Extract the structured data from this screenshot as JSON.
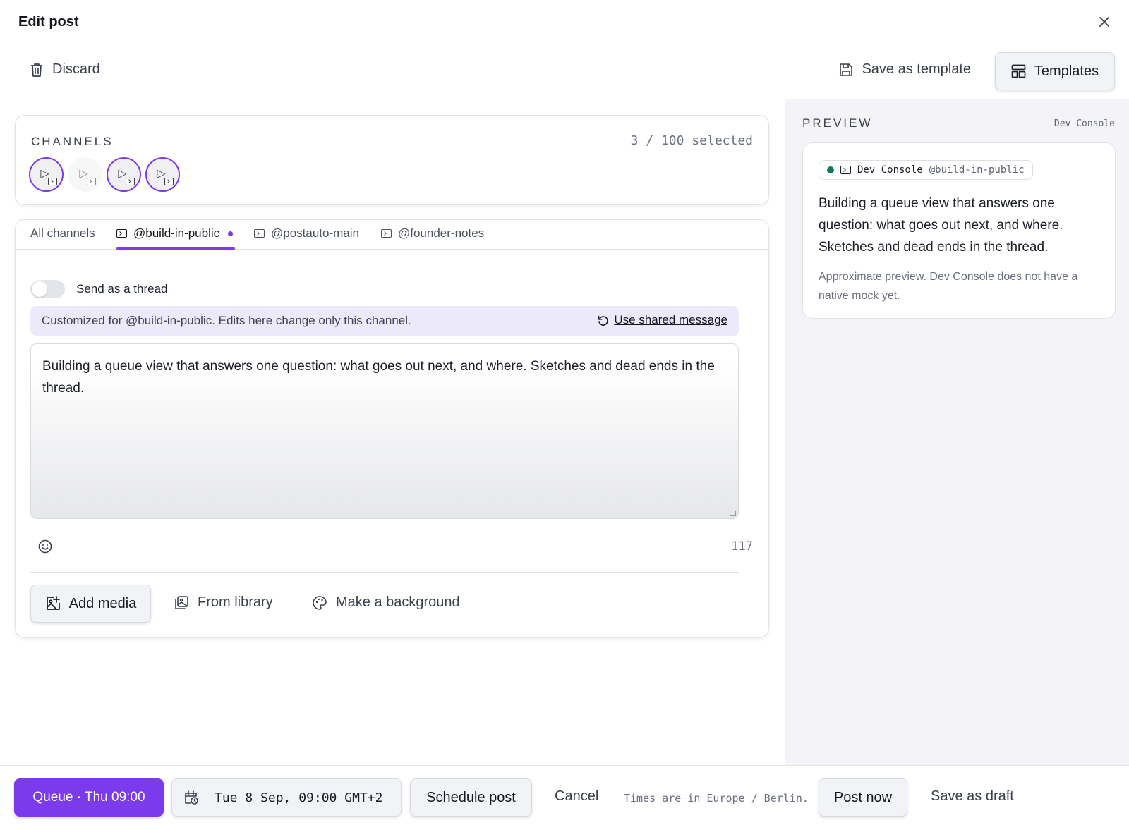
{
  "dialog": {
    "title": "Edit post"
  },
  "toolbar": {
    "discard_label": "Discard",
    "save_template_label": "Save as template",
    "templates_label": "Templates"
  },
  "channels": {
    "section_label": "CHANNELS",
    "selected_count": "3 / 100 selected",
    "avatars": [
      {
        "selected": true,
        "icon": "terminal-icon"
      },
      {
        "selected": false,
        "icon": "terminal-icon"
      },
      {
        "selected": true,
        "icon": "terminal-icon"
      },
      {
        "selected": true,
        "icon": "terminal-icon"
      }
    ]
  },
  "tabs": [
    {
      "label": "All channels",
      "active": false
    },
    {
      "label": "@build-in-public",
      "active": true,
      "edited": true
    },
    {
      "label": "@postauto-main",
      "active": false
    },
    {
      "label": "@founder-notes",
      "active": false
    }
  ],
  "editor": {
    "thread_toggle_label": "Send as a thread",
    "thread_toggle_on": false,
    "custom_notice": "Customized for @build-in-public. Edits here change only this channel.",
    "use_shared_label": "Use shared message",
    "message": "Building a queue view that answers one question: what goes out next, and where. Sketches and dead ends in the thread.",
    "char_count": "117"
  },
  "media": {
    "add_media_label": "Add media",
    "from_library_label": "From library",
    "background_label": "Make a background"
  },
  "preview": {
    "section_label": "PREVIEW",
    "channel_name": "Dev Console",
    "pill_name": "Dev Console",
    "pill_handle": "@build-in-public",
    "status_color": "#0f7a5a",
    "text": "Building a queue view that answers one question: what goes out next, and where. Sketches and dead ends in the thread.",
    "note": "Approximate preview. Dev Console does not have a native mock yet."
  },
  "footer": {
    "queue_label": "Queue · Thu 09:00",
    "datetime": "Tue 8 Sep, 09:00 GMT+2",
    "schedule_label": "Schedule post",
    "cancel_label": "Cancel",
    "timezone_note": "Times are in Europe / Berlin.",
    "post_now_label": "Post now",
    "save_draft_label": "Save as draft"
  },
  "colors": {
    "accent": "#7c3aed",
    "banner": "#ece9fb",
    "preview_bg": "#f3f3f8"
  }
}
